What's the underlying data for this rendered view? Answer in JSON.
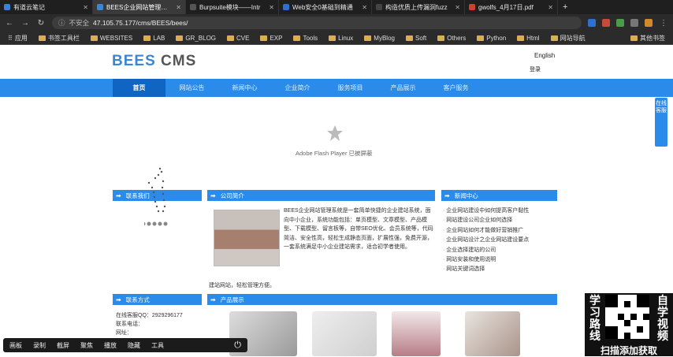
{
  "browser": {
    "tabs": [
      {
        "title": "有道云笔记",
        "color": "#3f7fd8",
        "active": false
      },
      {
        "title": "BEES企业网站管理系统",
        "color": "#3a86d6",
        "active": true
      },
      {
        "title": "Burpsuite模块——Intr",
        "color": "#555555",
        "active": false
      },
      {
        "title": "Web安全0基础到精通",
        "color": "#2f6fd0",
        "active": false
      },
      {
        "title": "构造优质上传漏洞fuzz",
        "color": "#444444",
        "active": false
      },
      {
        "title": "gwolfs_4月17日.pdf",
        "color": "#d33f2e",
        "active": false
      }
    ],
    "new_tab": "+",
    "security_label": "不安全",
    "url": "47.105.75.177/cms/BEES/bees/",
    "bookmarks": [
      "应用",
      "书签工具栏",
      "WEBSITES",
      "LAB",
      "GR_BLOG",
      "CVE",
      "EXP",
      "Tools",
      "Linux",
      "MyBlog",
      "Soft",
      "Others",
      "Python",
      "Html",
      "网站导航"
    ],
    "other_bookmarks": "其他书签"
  },
  "site": {
    "logo_bees": "BEES",
    "logo_cms": " CMS",
    "lang": "English",
    "login": "登录",
    "nav": [
      "首页",
      "网站公告",
      "新闻中心",
      "企业简介",
      "服务项目",
      "产品展示",
      "客户服务"
    ],
    "flash_text": "Adobe Flash Player 已被屏蔽",
    "side_button": "在线客服",
    "panels": {
      "left_top": "联系我们",
      "center_top": "公司简介",
      "right_top": "新闻中心",
      "left_bottom": "联系方式",
      "center_bottom": "产品展示"
    },
    "intro": "BEES企业网站管理系统是一套简单快捷的企业建站系统，面向中小企业，系统功能包括：单页模型、文章模型、产品模型、下载模型、留言板等，自带SEO优化、会员系统等，代码简洁、安全性高，轻松生成静态页面，扩展性强，免费开源，一套系统满足中小企业建站需求，适合初学者使用。",
    "intro_last": "建站网站，轻松管理方便。",
    "news": [
      "企业网站建设中如何提高客户黏性",
      "网站建设公司企业如何选择",
      "企业网站如何才能做好营销推广",
      "企业网站设计之企业网站建设要点",
      "企业选择建站的公司",
      "网站安装和使用说明",
      "网站关键词选择"
    ],
    "contact_qq": "在线客服QQ：2929296177",
    "contact_phone": "联系电话：",
    "contact_web": "网址："
  },
  "overlay": {
    "taskbar": [
      "画板",
      "录制",
      "截屏",
      "聚焦",
      "播放",
      "隐藏",
      "工具"
    ],
    "promo_left": "学习路线",
    "promo_right": "自学视频",
    "promo_caption": "扫描添加获取"
  }
}
